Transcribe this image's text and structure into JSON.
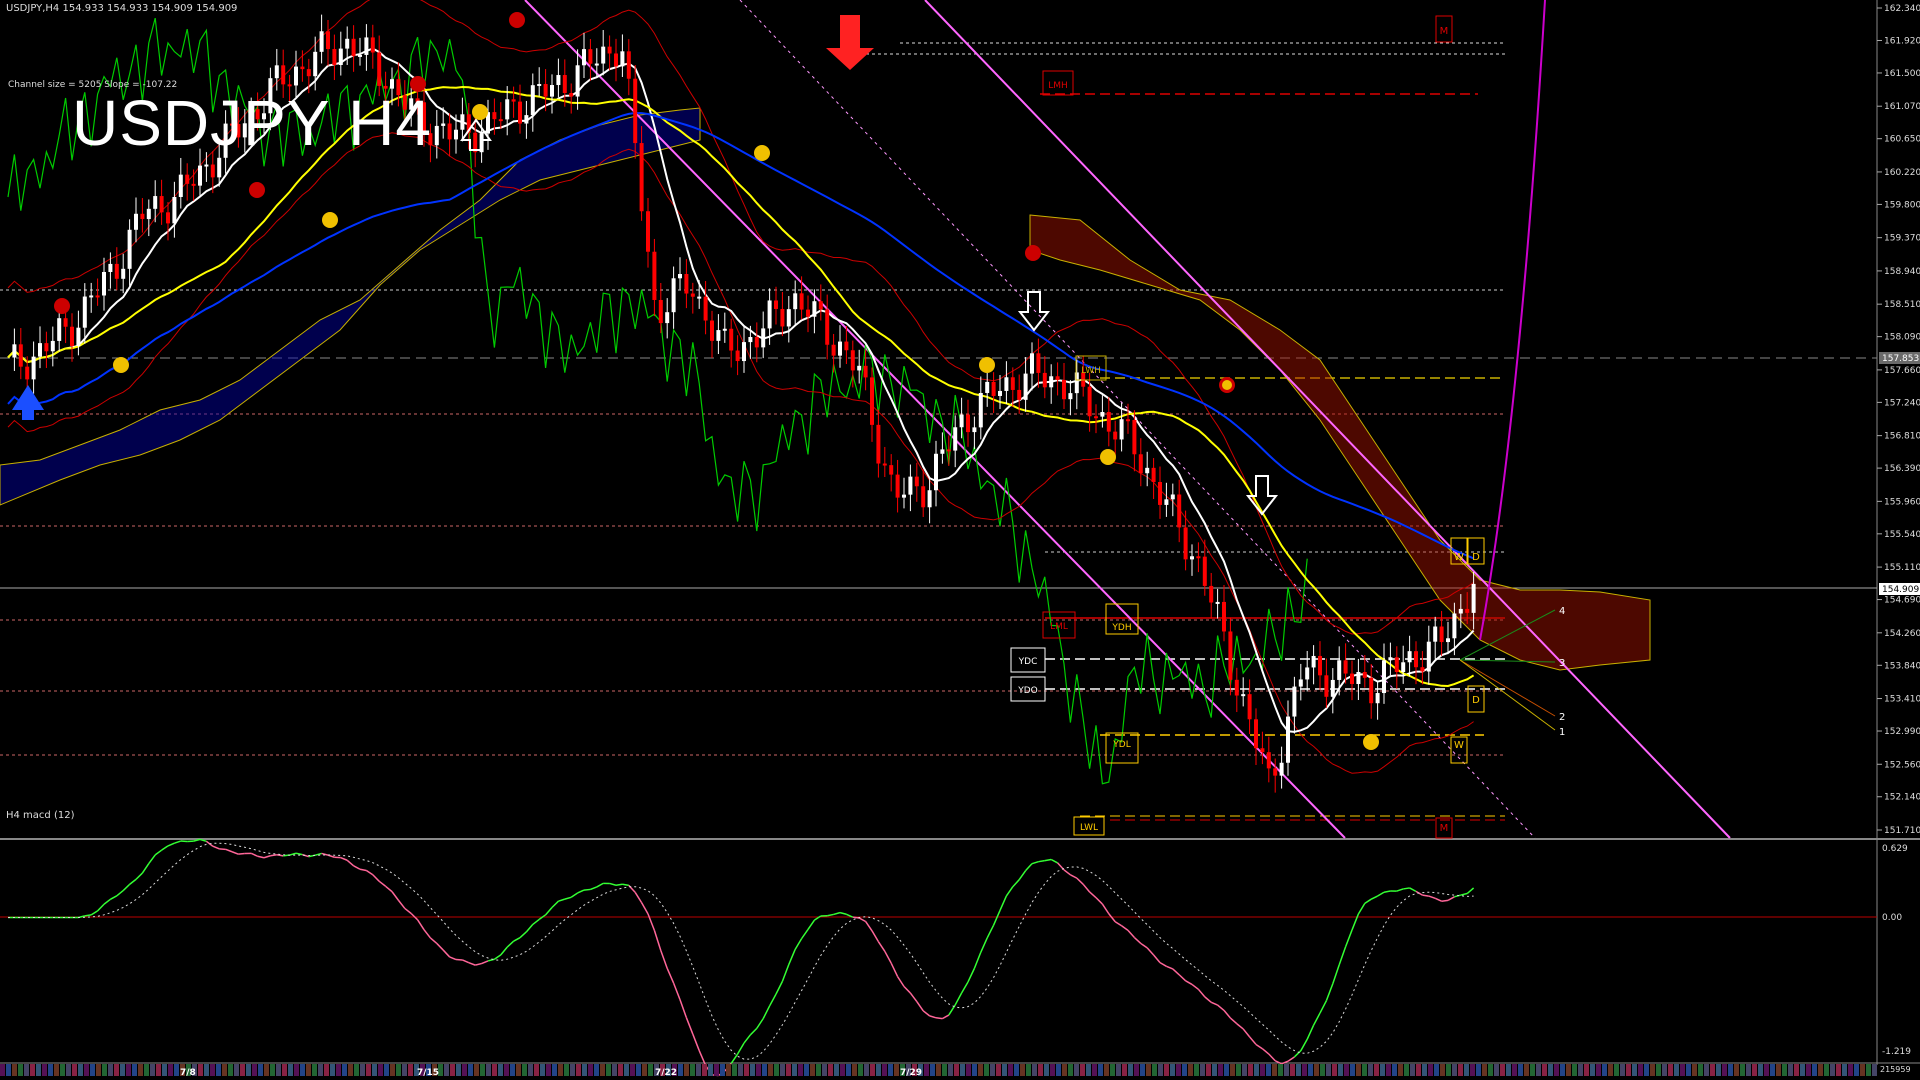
{
  "header": {
    "symbol_line": "USDJPY,H4  154.933 154.933 154.909 154.909",
    "channel_info": "Channel size = 5205  Slope = -107.22",
    "big_title": "USDJPY H4",
    "macd_label": "H4  macd (12)"
  },
  "price_axis": {
    "ticks": [
      "162.340",
      "161.920",
      "161.500",
      "161.070",
      "160.650",
      "160.220",
      "159.800",
      "159.370",
      "158.940",
      "158.510",
      "158.090",
      "157.660",
      "157.240",
      "156.810",
      "156.390",
      "155.960",
      "155.540",
      "155.110",
      "154.690",
      "154.260",
      "153.840",
      "153.410",
      "152.990",
      "152.560",
      "152.140",
      "151.710"
    ],
    "range": [
      151.71,
      162.34
    ],
    "current_price": "154.909",
    "marked_price": "157.853"
  },
  "macd_axis": {
    "top": "0.629",
    "zero": "0.00",
    "bottom": "-1.219",
    "corner": "215959"
  },
  "time_axis": {
    "labels": [
      "7/8",
      "7/15",
      "7/22",
      "7/29"
    ]
  },
  "level_labels": [
    "M",
    "LMH",
    "LWH",
    "LML",
    "YDH",
    "YDC",
    "YDO",
    "YDL",
    "LWL",
    "W",
    "D",
    "D",
    "W",
    "M"
  ],
  "fib_labels": [
    "4",
    "3",
    "2",
    "1"
  ],
  "colors": {
    "bull": "#ffffff",
    "bear": "#ff0000",
    "ma_white": "#ffffff",
    "ma_yellow": "#ffff00",
    "ma_blue": "#0033ff",
    "chikou_green": "#00cc00",
    "channel": "#ff66ff",
    "macd_main": "#33ff33",
    "macd_neg": "#ff6699"
  },
  "chart_data": {
    "type": "candlestick",
    "title": "USDJPY H4",
    "ylim": [
      151.71,
      162.34
    ],
    "x_labels": [
      "7/8",
      "7/15",
      "7/22",
      "7/29"
    ],
    "close_path": [
      157.7,
      157.9,
      158.3,
      158.9,
      159.7,
      159.9,
      160.4,
      160.9,
      161.4,
      161.7,
      161.9,
      161.5,
      160.9,
      160.7,
      160.8,
      161.1,
      161.3,
      161.6,
      161.9,
      158.4,
      158.8,
      157.9,
      158.1,
      158.6,
      158.2,
      157.6,
      156.0,
      156.2,
      157.0,
      157.4,
      157.6,
      157.5,
      157.1,
      156.7,
      155.9,
      155.1,
      153.7,
      152.3,
      153.8,
      153.7,
      153.6,
      153.9,
      154.1,
      154.9
    ],
    "macd_min": -1.219,
    "macd_max": 0.629
  }
}
